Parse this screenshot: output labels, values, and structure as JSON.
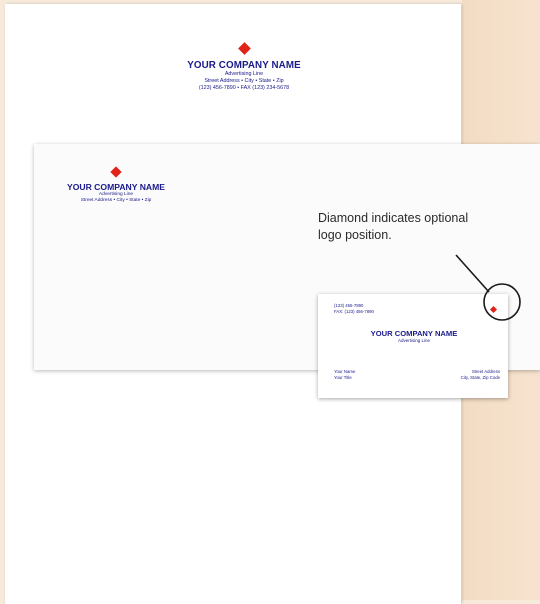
{
  "letterhead": {
    "company": "YOUR COMPANY NAME",
    "advertising": "Advertising Line",
    "address": "Street Address • City • State • Zip",
    "phone_fax": "(123) 456-7890 • FAX (123) 234-5678"
  },
  "envelope": {
    "company": "YOUR COMPANY NAME",
    "advertising": "Advertising Line",
    "address": "Street Address • City • State • Zip"
  },
  "business_card": {
    "phone": "(123) 456-7890",
    "fax": "FAX: (123) 456-7890",
    "company": "YOUR COMPANY NAME",
    "advertising": "Advertising Line",
    "name": "Your Name",
    "title": "Your Title",
    "street": "Street Address",
    "city_state_zip": "City, State, Zip Code"
  },
  "callout": {
    "line1": "Diamond indicates optional",
    "line2": "logo position."
  },
  "colors": {
    "ink": "#1a1a8a",
    "logo": "#e2231a",
    "background": "#f7eadb"
  },
  "icons": {
    "logo": "red-diamond-icon"
  }
}
